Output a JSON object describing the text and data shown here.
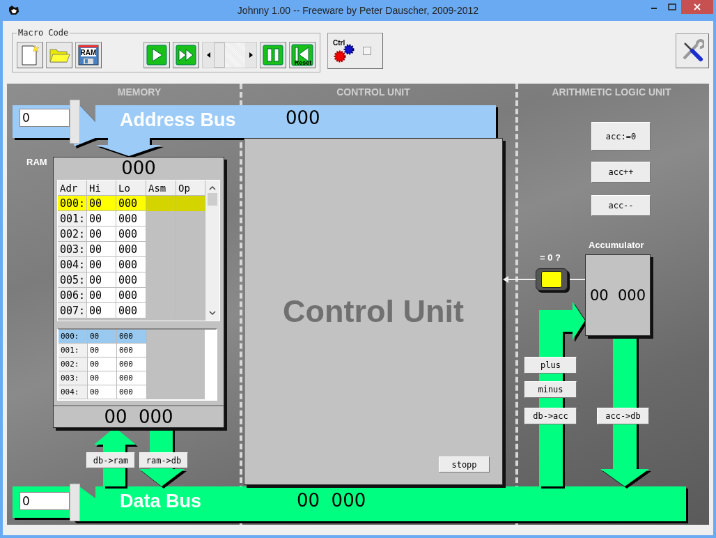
{
  "window": {
    "title": "Johnny 1.00 --  Freeware by Peter Dauscher, 2009-2012"
  },
  "toolbar": {
    "group_label": "Macro Code",
    "ram_icon_text": "RAM",
    "reset_icon_text": "Reset",
    "ctrl_icon_text": "Ctrl",
    "speed_slider": {
      "level": 0
    },
    "ctrl_checkbox": {
      "checked": false
    }
  },
  "sections": [
    "MEMORY",
    "CONTROL UNIT",
    "ARITHMETIC LOGIC UNIT"
  ],
  "address_bus": {
    "input": "0",
    "label": "Address Bus",
    "value": "000"
  },
  "ram": {
    "label": "RAM",
    "address": "000",
    "columns": [
      "Adr",
      "Hi",
      "Lo",
      "Asm",
      "Op"
    ],
    "rows": [
      {
        "adr": "000:",
        "hi": "00",
        "lo": "000",
        "selected": true
      },
      {
        "adr": "001:",
        "hi": "00",
        "lo": "000",
        "selected": false
      },
      {
        "adr": "002:",
        "hi": "00",
        "lo": "000",
        "selected": false
      },
      {
        "adr": "003:",
        "hi": "00",
        "lo": "000",
        "selected": false
      },
      {
        "adr": "004:",
        "hi": "00",
        "lo": "000",
        "selected": false
      },
      {
        "adr": "005:",
        "hi": "00",
        "lo": "000",
        "selected": false
      },
      {
        "adr": "006:",
        "hi": "00",
        "lo": "000",
        "selected": false
      },
      {
        "adr": "007:",
        "hi": "00",
        "lo": "000",
        "selected": false
      }
    ],
    "mini_rows": [
      {
        "adr": "000:",
        "hi": "00",
        "lo": "000",
        "selected": true
      },
      {
        "adr": "001:",
        "hi": "00",
        "lo": "000",
        "selected": false
      },
      {
        "adr": "002:",
        "hi": "00",
        "lo": "000",
        "selected": false
      },
      {
        "adr": "003:",
        "hi": "00",
        "lo": "000",
        "selected": false
      },
      {
        "adr": "004:",
        "hi": "00",
        "lo": "000",
        "selected": false
      }
    ],
    "data": "00  000",
    "buttons": [
      "db->ram",
      "ram->db"
    ]
  },
  "control_unit": {
    "label": "Control Unit",
    "button": "stopp"
  },
  "alu": {
    "buttons": [
      "acc:=0",
      "acc++",
      "acc--"
    ],
    "zero_label": "= 0 ?",
    "zero_flag": {
      "on": true
    },
    "accumulator_label": "Accumulator",
    "accumulator_value": "00  000",
    "op_buttons": [
      "plus",
      "minus",
      "db->acc"
    ],
    "out_button": "acc->db"
  },
  "data_bus": {
    "input": "0",
    "label": "Data Bus",
    "value": "00  000"
  }
}
